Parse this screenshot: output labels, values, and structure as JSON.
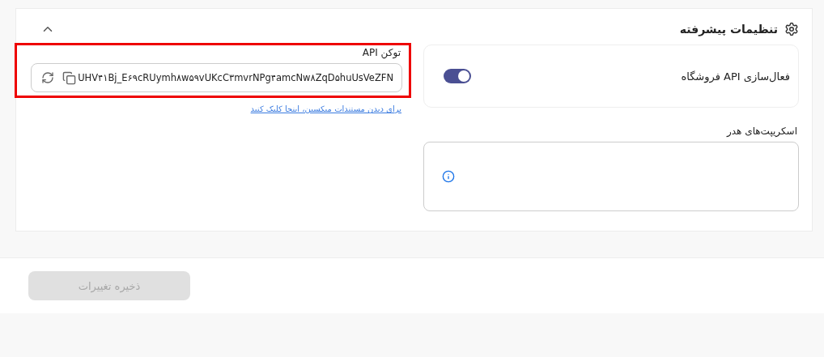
{
  "section": {
    "title": "تنظیمات پیشرفته",
    "expanded": true
  },
  "store_api": {
    "label": "فعال‌سازی API فروشگاه",
    "on": true
  },
  "header_scripts": {
    "label": "اسکریپت‌های هدر"
  },
  "api_token": {
    "label": "توکن API",
    "value": "UHV۴۱Bj_E۶۹cRUymh۸w۵۹vUKcC۳mvrNPg۴amcNw۸ZqD۵huUsVeZFN",
    "highlighted": true
  },
  "docs_link": "برای دیدن مستندات میکسین، اینجا کلیک کنید",
  "save_button": {
    "label": "ذخیره تغییرات",
    "disabled": true
  }
}
